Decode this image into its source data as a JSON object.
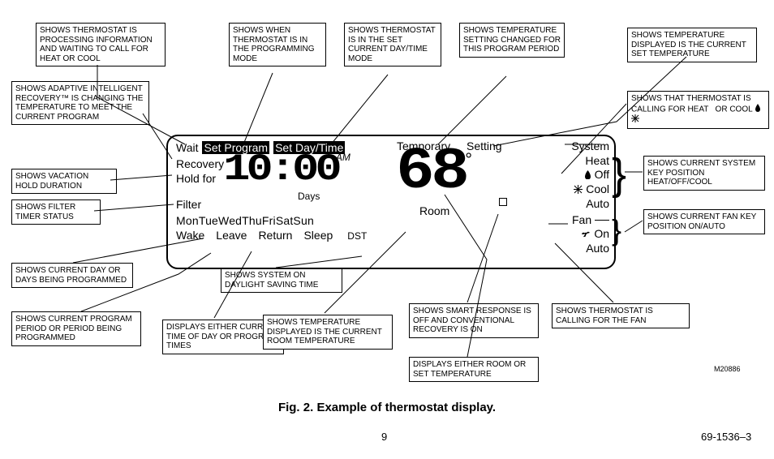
{
  "callouts": {
    "processing": "SHOWS THERMOSTAT IS PROCESSING INFORMATION AND WAITING TO CALL FOR HEAT OR COOL",
    "programming_mode": "SHOWS WHEN THERMOSTAT IS IN THE PROGRAMMING MODE",
    "set_daytime_mode": "SHOWS THERMOSTAT IS IN THE SET CURRENT DAY/TIME MODE",
    "temp_setting_changed": "SHOWS TEMPERATURE SETTING CHANGED FOR THIS PROGRAM PERIOD",
    "displayed_set_temp": "SHOWS TEMPERATURE DISPLAYED IS THE CURRENT SET TEMPERATURE",
    "adaptive_recovery": "SHOWS ADAPTIVE INTELLIGENT RECOVERY™ IS CHANGING THE TEMPERATURE TO MEET THE CURRENT PROGRAM",
    "calling_heat_cool": "SHOWS THAT THERMOSTAT IS CALLING FOR HEAT   OR COOL",
    "vacation_hold": "SHOWS VACATION HOLD DURATION",
    "system_key_pos": "SHOWS CURRENT SYSTEM KEY POSITION HEAT/OFF/COOL",
    "filter_timer": "SHOWS FILTER TIMER STATUS",
    "fan_key_pos": "SHOWS CURRENT FAN KEY POSITION ON/AUTO",
    "current_day": "SHOWS CURRENT DAY OR DAYS BEING PROGRAMMED",
    "dst": "SHOWS SYSTEM ON DAYLIGHT SAVING TIME",
    "smart_response_off": "SHOWS SMART RESPONSE IS OFF AND CONVENTIONAL RECOVERY IS ON",
    "calling_fan": "SHOWS THERMOSTAT IS CALLING FOR THE FAN",
    "current_period": "SHOWS CURRENT PROGRAM PERIOD OR PERIOD BEING PROGRAMMED",
    "displays_time": "DISPLAYS EITHER CURRENT TIME OF DAY OR PROGRAM TIMES",
    "displayed_room_temp": "SHOWS TEMPERATURE DISPLAYED IS THE CURRENT ROOM TEMPERATURE",
    "displays_room_or_set": "DISPLAYS EITHER ROOM OR SET TEMPERATURE"
  },
  "lcd": {
    "wait": "Wait",
    "set_program": "Set Program",
    "set_daytime": "Set Day/Time",
    "temporary": "Temporary",
    "setting": "Setting",
    "recovery": "Recovery",
    "hold_for": "Hold for",
    "time": "10:00",
    "ampm": "AM",
    "temp": "68",
    "degree": "°",
    "days_lbl": "Days",
    "filter": "Filter",
    "room": "Room",
    "days_of_week": "MonTueWedThuFriSatSun",
    "periods": {
      "wake": "Wake",
      "leave": "Leave",
      "return": "Return",
      "sleep": "Sleep"
    },
    "dst": "DST",
    "system": {
      "title": "System",
      "heat": "Heat",
      "off": "Off",
      "cool": "Cool",
      "auto": "Auto"
    },
    "fan": {
      "title": "Fan",
      "on": "On",
      "auto": "Auto"
    }
  },
  "footer": {
    "caption": "Fig. 2. Example of thermostat display.",
    "page": "9",
    "docnum": "69-1536–3",
    "partnum": "M20886"
  }
}
